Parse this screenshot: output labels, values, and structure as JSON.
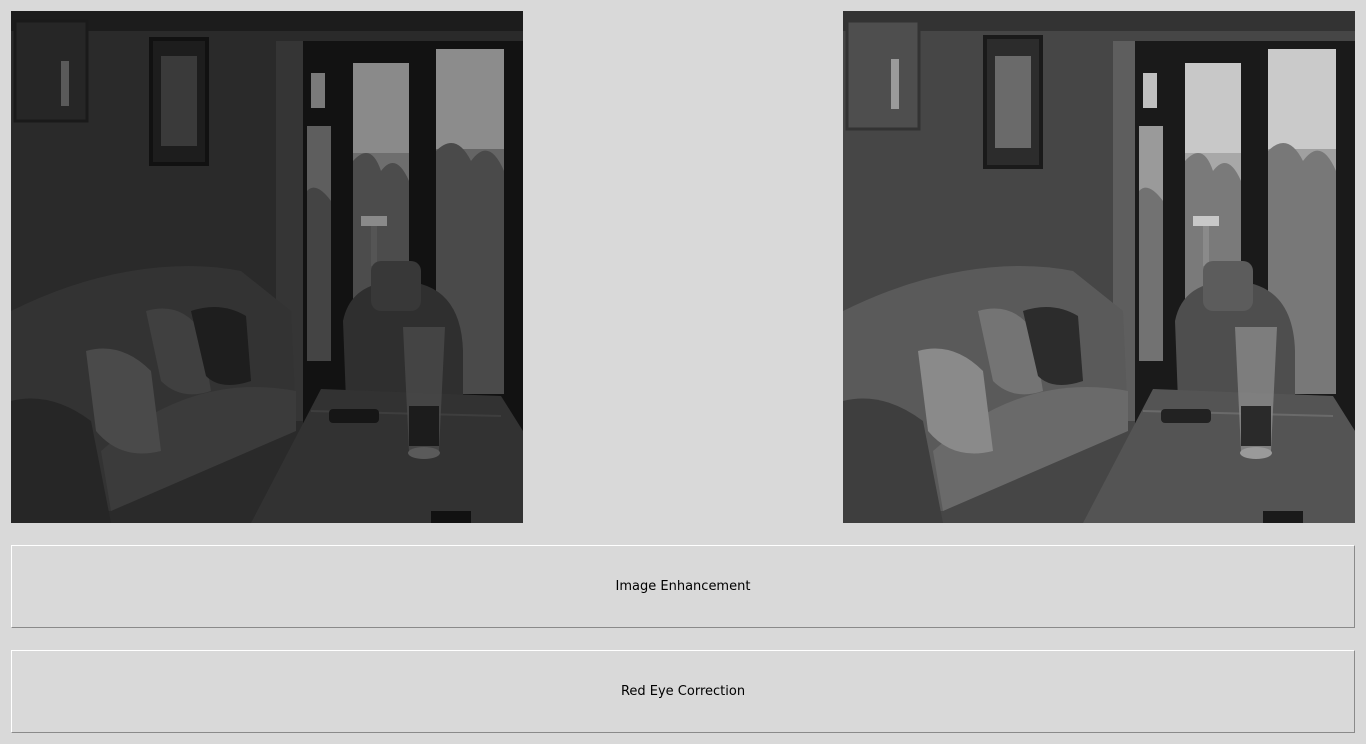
{
  "window": {
    "background": "#d9d9d9"
  },
  "images": {
    "original": {
      "icon": "dark-living-room-photo",
      "tone": "#2c2c2c"
    },
    "enhanced": {
      "icon": "enhanced-living-room-photo",
      "tone": "#474747"
    }
  },
  "buttons": {
    "enhance_label": "Image Enhancement",
    "redeye_label": "Red Eye Correction"
  }
}
